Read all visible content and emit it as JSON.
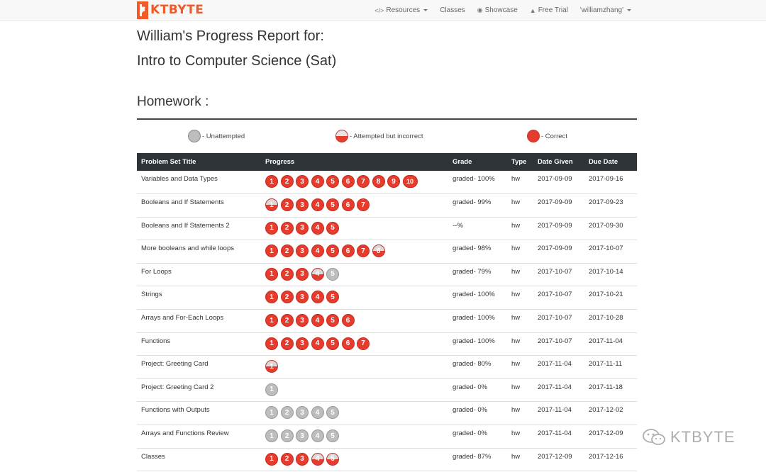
{
  "brand": {
    "text": "KTBYTE"
  },
  "nav": {
    "resources": "Resources",
    "classes": "Classes",
    "showcase": "Showcase",
    "free_trial": "Free Trial",
    "user": "'williamzhang'"
  },
  "report": {
    "title": "William's Progress Report for:",
    "course": "Intro to Computer Science (Sat)",
    "section": "Homework :"
  },
  "legend": {
    "unattempted": "- Unattempted",
    "attempted": "- Attempted but incorrect",
    "correct": "- Correct"
  },
  "table": {
    "headers": {
      "title": "Problem Set Title",
      "progress": "Progress",
      "grade": "Grade",
      "type": "Type",
      "date_given": "Date Given",
      "due_date": "Due Date"
    },
    "rows": [
      {
        "title": "Variables and Data Types",
        "progress": [
          "c",
          "c",
          "c",
          "c",
          "c",
          "c",
          "c",
          "c",
          "c",
          "c"
        ],
        "grade": "graded- 100%",
        "type": "hw",
        "given": "2017-09-09",
        "due": "2017-09-16"
      },
      {
        "title": "Booleans and If Statements",
        "progress": [
          "p",
          "c",
          "c",
          "c",
          "c",
          "c",
          "c"
        ],
        "grade": "graded- 99%",
        "type": "hw",
        "given": "2017-09-09",
        "due": "2017-09-23"
      },
      {
        "title": "Booleans and If Statements 2",
        "progress": [
          "c",
          "c",
          "c",
          "c",
          "c"
        ],
        "grade": "--%",
        "type": "hw",
        "given": "2017-09-09",
        "due": "2017-09-30"
      },
      {
        "title": "More booleans and while loops",
        "progress": [
          "c",
          "c",
          "c",
          "c",
          "c",
          "c",
          "c",
          "p"
        ],
        "grade": "graded- 98%",
        "type": "hw",
        "given": "2017-09-09",
        "due": "2017-10-07"
      },
      {
        "title": "For Loops",
        "progress": [
          "c",
          "c",
          "c",
          "p",
          "u"
        ],
        "grade": "graded- 79%",
        "type": "hw",
        "given": "2017-10-07",
        "due": "2017-10-14"
      },
      {
        "title": "Strings",
        "progress": [
          "c",
          "c",
          "c",
          "c",
          "c"
        ],
        "grade": "graded- 100%",
        "type": "hw",
        "given": "2017-10-07",
        "due": "2017-10-21"
      },
      {
        "title": "Arrays and For-Each Loops",
        "progress": [
          "c",
          "c",
          "c",
          "c",
          "c",
          "c"
        ],
        "grade": "graded- 100%",
        "type": "hw",
        "given": "2017-10-07",
        "due": "2017-10-28"
      },
      {
        "title": "Functions",
        "progress": [
          "c",
          "c",
          "c",
          "c",
          "c",
          "c",
          "c"
        ],
        "grade": "graded- 100%",
        "type": "hw",
        "given": "2017-10-07",
        "due": "2017-11-04"
      },
      {
        "title": "Project: Greeting Card",
        "progress": [
          "p"
        ],
        "grade": "graded- 80%",
        "type": "hw",
        "given": "2017-11-04",
        "due": "2017-11-11"
      },
      {
        "title": "Project: Greeting Card 2",
        "progress": [
          "u"
        ],
        "grade": "graded- 0%",
        "type": "hw",
        "given": "2017-11-04",
        "due": "2017-11-18"
      },
      {
        "title": "Functions with Outputs",
        "progress": [
          "u",
          "u",
          "u",
          "u",
          "u"
        ],
        "grade": "graded- 0%",
        "type": "hw",
        "given": "2017-11-04",
        "due": "2017-12-02"
      },
      {
        "title": "Arrays and Functions Review",
        "progress": [
          "u",
          "u",
          "u",
          "u",
          "u"
        ],
        "grade": "graded- 0%",
        "type": "hw",
        "given": "2017-11-04",
        "due": "2017-12-09"
      },
      {
        "title": "Classes",
        "progress": [
          "c",
          "c",
          "c",
          "p",
          "p"
        ],
        "grade": "graded- 87%",
        "type": "hw",
        "given": "2017-12-09",
        "due": "2017-12-16"
      }
    ]
  },
  "watermark": {
    "text": "KTBYTE"
  }
}
